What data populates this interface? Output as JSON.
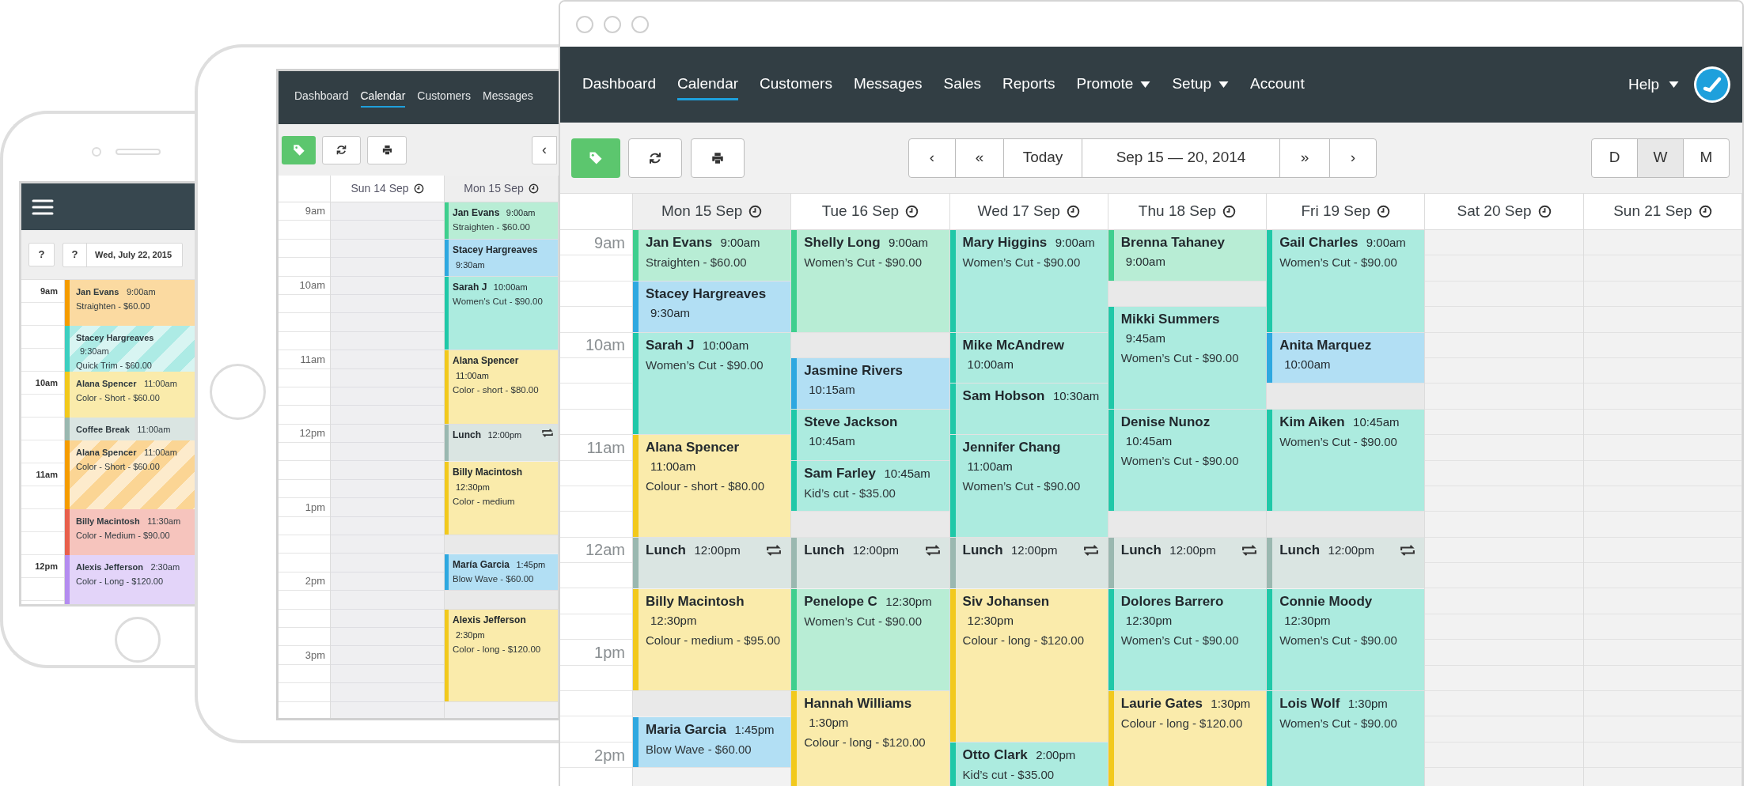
{
  "phone": {
    "toolbar": {
      "button": "?",
      "date_button": "?",
      "date": "Wed, July 22, 2015"
    },
    "time_labels": [
      "9am",
      "10am",
      "11am",
      "12pm"
    ],
    "events": [
      {
        "name": "Jan Evans",
        "time": "9:00am",
        "service": "Straighten - $60.00",
        "color": "#f59c00",
        "striped": false,
        "kind": "half"
      },
      {
        "name": "Stacey Hargreaves",
        "time": "9:30am",
        "service": "Quick Trim - $60.00",
        "color": "#3ccfc0",
        "striped": true,
        "kind": "half"
      },
      {
        "name": "Alana Spencer",
        "time": "11:00am",
        "service": "Color - Short - $60.00",
        "color": "#f2c91c",
        "striped": false,
        "kind": "half"
      },
      {
        "name": "Coffee Break",
        "time": "11:00am",
        "color": "#9ab8b0",
        "striped": false,
        "kind": "quarter"
      },
      {
        "name": "Alana Spencer",
        "time": "11:00am",
        "service": "Color - Short - $60.00",
        "color": "#f59c00",
        "striped": true,
        "kind": "three_quarter"
      },
      {
        "name": "Billy Macintosh",
        "time": "11:30am",
        "service": "Color - Medium - $90.00",
        "color": "#e8604c",
        "striped": false,
        "kind": "half"
      },
      {
        "name": "Alexis Jefferson",
        "time": "2:30am",
        "service": "Color - Long - $120.00",
        "color": "#b48cf0",
        "striped": false,
        "kind": "three_quarter"
      }
    ]
  },
  "tablet": {
    "nav": [
      {
        "label": "Dashboard",
        "selected": false
      },
      {
        "label": "Calendar",
        "selected": true
      },
      {
        "label": "Customers",
        "selected": false
      },
      {
        "label": "Messages",
        "selected": false
      }
    ],
    "nav_back": "‹",
    "time_labels": [
      "9am",
      "10am",
      "11am",
      "12pm",
      "1pm",
      "2pm",
      "3pm"
    ],
    "days": [
      {
        "label": "Sun 14 Sep",
        "highlighted": false
      },
      {
        "label": "Mon 15 Sep",
        "highlighted": true,
        "events": [
          {
            "name": "Jan Evans",
            "time": "9:00am",
            "service": "Straighten - $60.00",
            "color": "#3ecf8e",
            "recurring": false,
            "kind": "half"
          },
          {
            "name": "Stacey Hargreaves",
            "time": "9:30am",
            "color": "#2ea8e0",
            "recurring": false,
            "kind": "half"
          },
          {
            "name": "Sarah J",
            "time": "10:00am",
            "service": "Women's Cut - $90.00",
            "color": "#1fc8a8",
            "recurring": false,
            "kind": "hour"
          },
          {
            "name": "Alana Spencer",
            "time": "11:00am",
            "service": "Color - short - $80.00",
            "color": "#f2c91c",
            "recurring": false,
            "kind": "hour"
          },
          {
            "name": "Lunch",
            "time": "12:00pm",
            "color": "#9ab8b0",
            "recurring": true,
            "kind": "half"
          },
          {
            "name": "Billy Macintosh",
            "time": "12:30pm",
            "service": "Color - medium",
            "color": "#f2c91c",
            "recurring": false,
            "kind": "hour"
          },
          {
            "kind": "free"
          },
          {
            "name": "María Garcia",
            "time": "1:45pm",
            "service": "Blow Wave - $60.00",
            "color": "#2ea8e0",
            "recurring": false,
            "kind": "half"
          },
          {
            "kind": "free"
          },
          {
            "name": "Alexis Jefferson",
            "time": "2:30pm",
            "service": "Color - long - $120.00",
            "color": "#f2c91c",
            "recurring": false,
            "kind": "hour_quarter"
          }
        ]
      }
    ]
  },
  "desktop": {
    "nav": [
      {
        "label": "Dashboard",
        "selected": false,
        "has_menu": false
      },
      {
        "label": "Calendar",
        "selected": true,
        "has_menu": false
      },
      {
        "label": "Customers",
        "selected": false,
        "has_menu": false
      },
      {
        "label": "Messages",
        "selected": false,
        "has_menu": false
      },
      {
        "label": "Sales",
        "selected": false,
        "has_menu": false
      },
      {
        "label": "Reports",
        "selected": false,
        "has_menu": false
      },
      {
        "label": "Promote",
        "selected": false,
        "has_menu": true
      },
      {
        "label": "Setup",
        "selected": false,
        "has_menu": true
      },
      {
        "label": "Account",
        "selected": false,
        "has_menu": false
      }
    ],
    "help": "Help",
    "navigator": [
      "‹",
      "«",
      "Today",
      "Sep 15 — 20, 2014",
      "»",
      "›"
    ],
    "views": [
      {
        "label": "D",
        "selected": false
      },
      {
        "label": "W",
        "selected": true
      },
      {
        "label": "M",
        "selected": false
      }
    ],
    "time_labels": [
      "9am",
      "10am",
      "11am",
      "12am",
      "1pm",
      "2pm"
    ],
    "days": [
      {
        "label": "Mon 15 Sep",
        "highlighted": true,
        "events": [
          {
            "name": "Jan Evans",
            "time": "9:00am",
            "service": "Straighten - $60.00",
            "color": "#3ecf8e",
            "recurring": false,
            "kind": "half"
          },
          {
            "name": "Stacey Hargreaves",
            "time": "9:30am",
            "color": "#2ea8e0",
            "recurring": false,
            "kind": "half"
          },
          {
            "name": "Sarah J",
            "time": "10:00am",
            "service": "Women’s Cut - $90.00",
            "color": "#1fc8a8",
            "recurring": false,
            "kind": "hour"
          },
          {
            "name": "Alana Spencer",
            "time": "11:00am",
            "service": "Colour - short - $80.00",
            "color": "#f2c91c",
            "recurring": false,
            "kind": "hour"
          },
          {
            "name": "Lunch",
            "time": "12:00pm",
            "color": "#9ab8b0",
            "recurring": true,
            "kind": "half"
          },
          {
            "name": "Billy Macintosh",
            "time": "12:30pm",
            "service": "Colour - medium - $95.00",
            "color": "#f2c91c",
            "recurring": false,
            "kind": "hour"
          },
          {
            "kind": "free"
          },
          {
            "name": "Maria Garcia",
            "time": "1:45pm",
            "service": "Blow Wave - $60.00",
            "color": "#2ea8e0",
            "recurring": false,
            "kind": "half"
          }
        ]
      },
      {
        "label": "Tue 16 Sep",
        "highlighted": false,
        "events": [
          {
            "name": "Shelly Long",
            "time": "9:00am",
            "service": "Women’s Cut - $90.00",
            "color": "#3ecf8e",
            "recurring": false,
            "kind": "hour"
          },
          {
            "kind": "free"
          },
          {
            "name": "Jasmine Rivers",
            "time": "10:15am",
            "color": "#2ea8e0",
            "recurring": false,
            "kind": "half"
          },
          {
            "name": "Steve Jackson",
            "time": "10:45am",
            "color": "#1fc8a8",
            "recurring": false,
            "kind": "half"
          },
          {
            "name": "Sam Farley",
            "time": "10:45am",
            "service": "Kid’s cut - $35.00",
            "color": "#1fc8a8",
            "recurring": false,
            "kind": "half"
          },
          {
            "kind": "free"
          },
          {
            "name": "Lunch",
            "time": "12:00pm",
            "color": "#9ab8b0",
            "recurring": true,
            "kind": "half"
          },
          {
            "name": "Penelope C",
            "time": "12:30pm",
            "service": "Women’s Cut - $90.00",
            "color": "#3ecf8e",
            "recurring": false,
            "kind": "hour"
          },
          {
            "name": "Hannah Williams",
            "time": "1:30pm",
            "service": "Colour - long - $120.00",
            "color": "#f2c91c",
            "recurring": false,
            "kind": "hour_quarter"
          }
        ]
      },
      {
        "label": "Wed 17 Sep",
        "highlighted": false,
        "events": [
          {
            "name": "Mary Higgins",
            "time": "9:00am",
            "service": "Women’s Cut - $90.00",
            "color": "#1fc8a8",
            "recurring": false,
            "kind": "hour"
          },
          {
            "name": "Mike McAndrew",
            "time": "10:00am",
            "color": "#1fc8a8",
            "recurring": false,
            "kind": "half"
          },
          {
            "name": "Sam Hobson",
            "time": "10:30am",
            "color": "#1fc8a8",
            "recurring": false,
            "kind": "half"
          },
          {
            "name": "Jennifer Chang",
            "time": "11:00am",
            "service": "Women’s Cut - $90.00",
            "color": "#1fc8a8",
            "recurring": false,
            "kind": "hour"
          },
          {
            "name": "Lunch",
            "time": "12:00pm",
            "color": "#9ab8b0",
            "recurring": true,
            "kind": "half"
          },
          {
            "name": "Siv Johansen",
            "time": "12:30pm",
            "service": "Colour - long - $120.00",
            "color": "#f2c91c",
            "recurring": false,
            "kind": "hour_half"
          },
          {
            "name": "Otto Clark",
            "time": "2:00pm",
            "service": "Kid’s cut - $35.00",
            "color": "#1fc8a8",
            "recurring": false,
            "kind": "three_quarter"
          }
        ]
      },
      {
        "label": "Thu 18 Sep",
        "highlighted": false,
        "events": [
          {
            "name": "Brenna Tahaney",
            "time": "9:00am",
            "color": "#3ecf8e",
            "recurring": false,
            "kind": "half"
          },
          {
            "kind": "free"
          },
          {
            "name": "Mikki Summers",
            "time": "9:45am",
            "service": "Women’s Cut - $90.00",
            "color": "#1fc8a8",
            "recurring": false,
            "kind": "hour"
          },
          {
            "name": "Denise Nunoz",
            "time": "10:45am",
            "service": "Women’s Cut - $90.00",
            "color": "#1fc8a8",
            "recurring": false,
            "kind": "hour"
          },
          {
            "kind": "free"
          },
          {
            "name": "Lunch",
            "time": "12:00pm",
            "color": "#9ab8b0",
            "recurring": true,
            "kind": "half"
          },
          {
            "name": "Dolores Barrero",
            "time": "12:30pm",
            "service": "Women’s Cut - $90.00",
            "color": "#1fc8a8",
            "recurring": false,
            "kind": "hour"
          },
          {
            "name": "Laurie Gates",
            "time": "1:30pm",
            "service": "Colour - long - $120.00",
            "color": "#f2c91c",
            "recurring": false,
            "kind": "hour_quarter"
          }
        ]
      },
      {
        "label": "Fri 19 Sep",
        "highlighted": false,
        "events": [
          {
            "name": "Gail Charles",
            "time": "9:00am",
            "service": "Women’s Cut - $90.00",
            "color": "#1fc8a8",
            "recurring": false,
            "kind": "hour"
          },
          {
            "name": "Anita Marquez",
            "time": "10:00am",
            "color": "#2ea8e0",
            "recurring": false,
            "kind": "half"
          },
          {
            "kind": "free"
          },
          {
            "name": "Kim Aiken",
            "time": "10:45am",
            "service": "Women’s Cut - $90.00",
            "color": "#1fc8a8",
            "recurring": false,
            "kind": "hour"
          },
          {
            "kind": "free"
          },
          {
            "name": "Lunch",
            "time": "12:00pm",
            "color": "#9ab8b0",
            "recurring": true,
            "kind": "half"
          },
          {
            "name": "Connie Moody",
            "time": "12:30pm",
            "service": "Women’s Cut - $90.00",
            "color": "#1fc8a8",
            "recurring": false,
            "kind": "hour"
          },
          {
            "name": "Lois Wolf",
            "time": "1:30pm",
            "service": "Women’s Cut - $90.00",
            "color": "#1fc8a8",
            "recurring": false,
            "kind": "hour_quarter"
          }
        ]
      },
      {
        "label": "Sat 20 Sep",
        "highlighted": false
      },
      {
        "label": "Sun 21 Sep",
        "highlighted": false
      }
    ]
  }
}
